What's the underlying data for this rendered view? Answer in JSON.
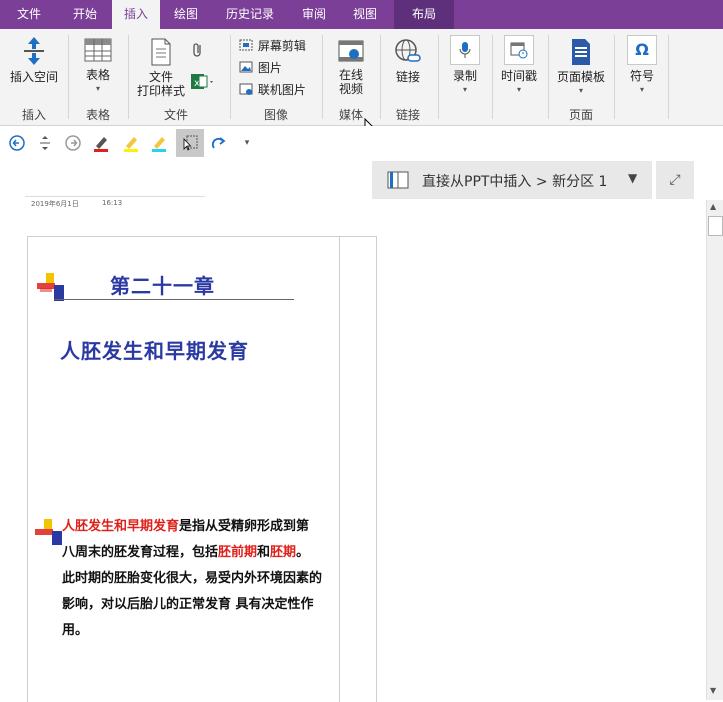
{
  "tabs": [
    {
      "label": "文件",
      "active": false
    },
    {
      "label": "开始",
      "active": false
    },
    {
      "label": "插入",
      "active": true
    },
    {
      "label": "绘图",
      "active": false
    },
    {
      "label": "历史记录",
      "active": false
    },
    {
      "label": "审阅",
      "active": false
    },
    {
      "label": "视图",
      "active": false
    },
    {
      "label": "布局",
      "active": false
    }
  ],
  "ribbon": {
    "insert_space": "插入空间",
    "table": "表格",
    "file_printout_1": "文件",
    "file_printout_2": "打印样式",
    "screen_clipping": "屏幕剪辑",
    "pictures": "图片",
    "online_pictures": "联机图片",
    "online_video_1": "在线",
    "online_video_2": "视频",
    "link": "链接",
    "record": "录制",
    "timestamp": "时间戳",
    "page_templates": "页面模板",
    "symbol": "符号",
    "groups": {
      "insert": "插入",
      "tables": "表格",
      "files": "文件",
      "images": "图像",
      "media": "媒体",
      "links": "链接",
      "pages": "页面"
    }
  },
  "notebook": {
    "breadcrumb": "直接从PPT中插入 > 新分区 1"
  },
  "page": {
    "date": "2019年6月1日",
    "time": "16:13"
  },
  "slide": {
    "chapter": "第二十一章",
    "heading": "人胚发生和早期发育",
    "body_red_1": "人胚发生和早期发育",
    "body_black_1": "是指从受精卵形成到第八周末的胚发育过程，包括",
    "body_red_2": "胚前期",
    "body_black_2": "和",
    "body_red_3": "胚期",
    "body_black_3": "。此时期的胚胎变化很大，易受内外环境因素的影响，对以后胎儿的正常发育 具有决定性作用。"
  },
  "colors": {
    "tab_bar": "#7b3f98",
    "slide_title": "#2b3aa3",
    "body_red": "#e0201a",
    "accent_blue": "#1e6fc2"
  }
}
